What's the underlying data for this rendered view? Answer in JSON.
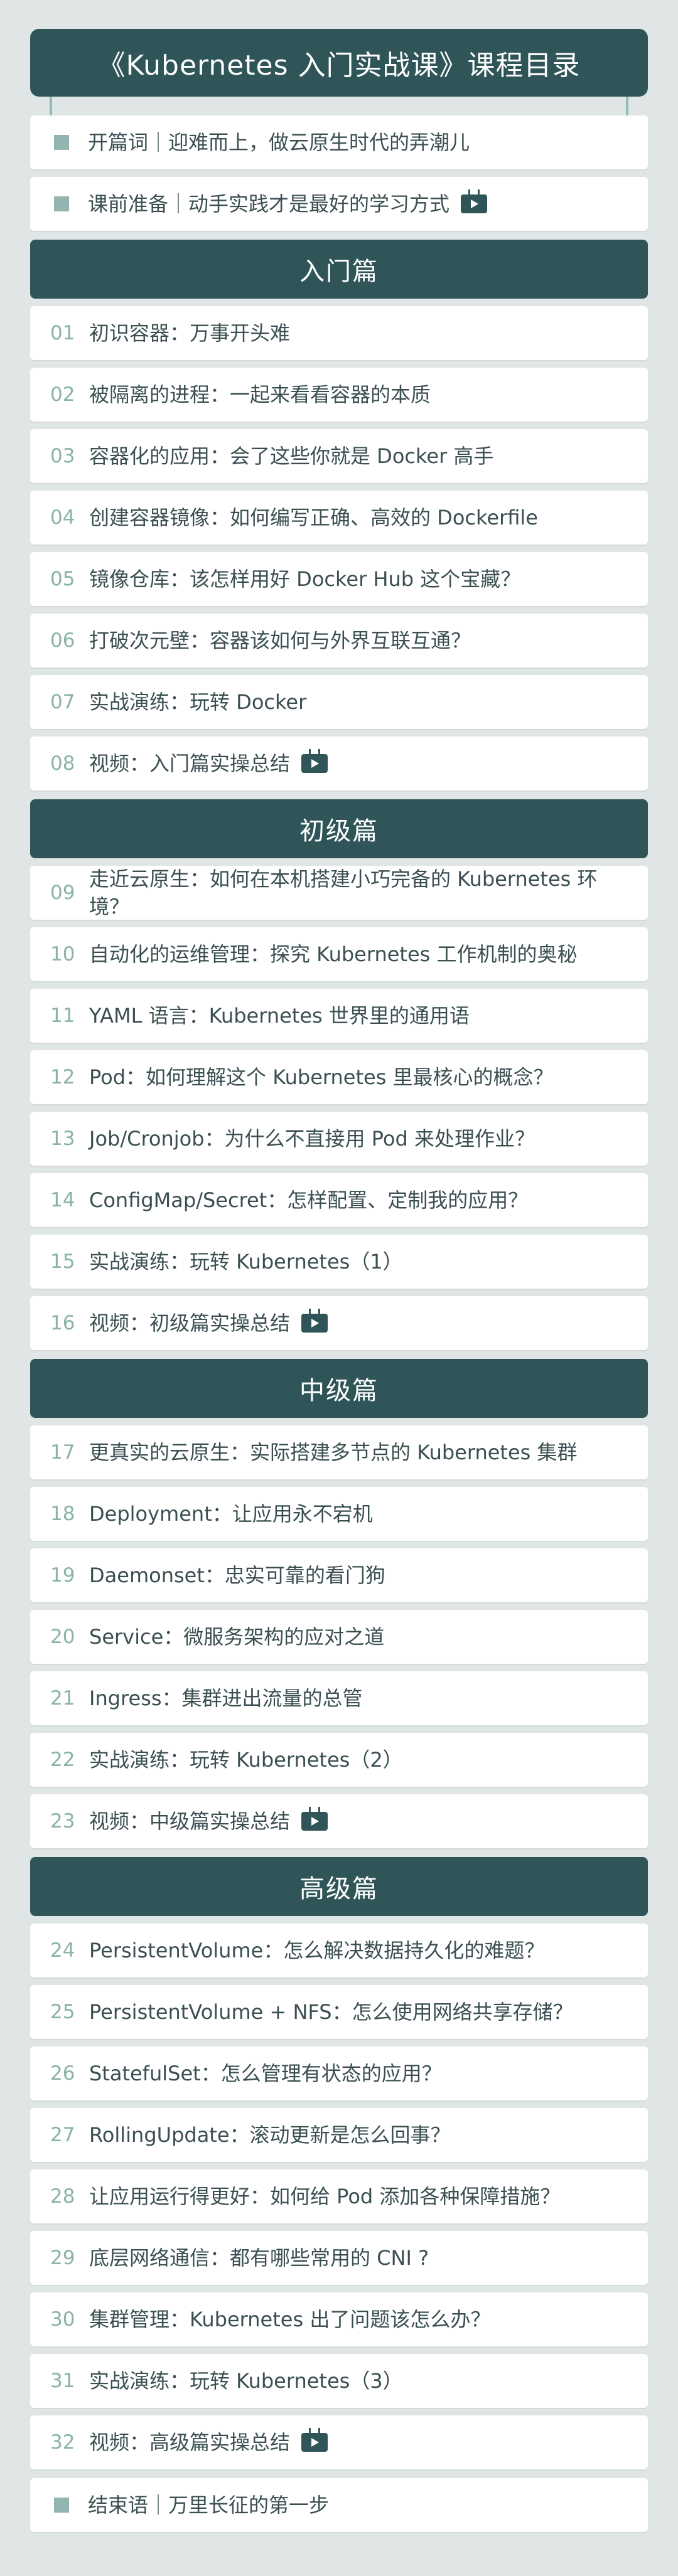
{
  "title": "《Kubernetes 入门实战课》课程目录",
  "intro": [
    {
      "label": "开篇词｜迎难而上，做云原生时代的弄潮儿",
      "video": false
    },
    {
      "label": "课前准备｜动手实践才是最好的学习方式",
      "video": true
    }
  ],
  "sections": [
    {
      "title": "入门篇",
      "items": [
        {
          "num": "01",
          "label": "初识容器：万事开头难",
          "video": false
        },
        {
          "num": "02",
          "label": "被隔离的进程：一起来看看容器的本质",
          "video": false
        },
        {
          "num": "03",
          "label": "容器化的应用：会了这些你就是 Docker 高手",
          "video": false
        },
        {
          "num": "04",
          "label": "创建容器镜像：如何编写正确、高效的 Dockerfile",
          "video": false
        },
        {
          "num": "05",
          "label": "镜像仓库：该怎样用好 Docker Hub 这个宝藏？",
          "video": false
        },
        {
          "num": "06",
          "label": "打破次元壁：容器该如何与外界互联互通？",
          "video": false
        },
        {
          "num": "07",
          "label": "实战演练：玩转 Docker",
          "video": false
        },
        {
          "num": "08",
          "label": "视频：入门篇实操总结",
          "video": true
        }
      ]
    },
    {
      "title": "初级篇",
      "items": [
        {
          "num": "09",
          "label": "走近云原生：如何在本机搭建小巧完备的 Kubernetes 环境？",
          "video": false
        },
        {
          "num": "10",
          "label": "自动化的运维管理：探究 Kubernetes 工作机制的奥秘",
          "video": false
        },
        {
          "num": "11",
          "label": "YAML 语言：Kubernetes 世界里的通用语",
          "video": false
        },
        {
          "num": "12",
          "label": "Pod：如何理解这个 Kubernetes 里最核心的概念？",
          "video": false
        },
        {
          "num": "13",
          "label": "Job/Cronjob：为什么不直接用 Pod 来处理作业？",
          "video": false
        },
        {
          "num": "14",
          "label": "ConfigMap/Secret：怎样配置、定制我的应用？",
          "video": false
        },
        {
          "num": "15",
          "label": "实战演练：玩转 Kubernetes（1）",
          "video": false
        },
        {
          "num": "16",
          "label": "视频：初级篇实操总结",
          "video": true
        }
      ]
    },
    {
      "title": "中级篇",
      "items": [
        {
          "num": "17",
          "label": "更真实的云原生：实际搭建多节点的 Kubernetes 集群",
          "video": false
        },
        {
          "num": "18",
          "label": "Deployment：让应用永不宕机",
          "video": false
        },
        {
          "num": "19",
          "label": "Daemonset：忠实可靠的看门狗",
          "video": false
        },
        {
          "num": "20",
          "label": "Service：微服务架构的应对之道",
          "video": false
        },
        {
          "num": "21",
          "label": "Ingress：集群进出流量的总管",
          "video": false
        },
        {
          "num": "22",
          "label": "实战演练：玩转 Kubernetes（2）",
          "video": false
        },
        {
          "num": "23",
          "label": "视频：中级篇实操总结",
          "video": true
        }
      ]
    },
    {
      "title": "高级篇",
      "items": [
        {
          "num": "24",
          "label": "PersistentVolume：怎么解决数据持久化的难题？",
          "video": false
        },
        {
          "num": "25",
          "label": "PersistentVolume + NFS：怎么使用网络共享存储？",
          "video": false
        },
        {
          "num": "26",
          "label": "StatefulSet：怎么管理有状态的应用？",
          "video": false
        },
        {
          "num": "27",
          "label": "RollingUpdate：滚动更新是怎么回事？",
          "video": false
        },
        {
          "num": "28",
          "label": "让应用运行得更好：如何给 Pod 添加各种保障措施？",
          "video": false
        },
        {
          "num": "29",
          "label": "底层网络通信：都有哪些常用的 CNI ?",
          "video": false
        },
        {
          "num": "30",
          "label": "集群管理：Kubernetes 出了问题该怎么办？",
          "video": false
        },
        {
          "num": "31",
          "label": "实战演练：玩转 Kubernetes（3）",
          "video": false
        },
        {
          "num": "32",
          "label": "视频：高级篇实操总结",
          "video": true
        }
      ]
    }
  ],
  "outro": [
    {
      "label": "结束语｜万里长征的第一步",
      "video": false
    }
  ],
  "colors": {
    "primary": "#2f5558",
    "accent": "#8fbcb6",
    "background": "#dfe6e5",
    "number": "#8ab2ab"
  }
}
